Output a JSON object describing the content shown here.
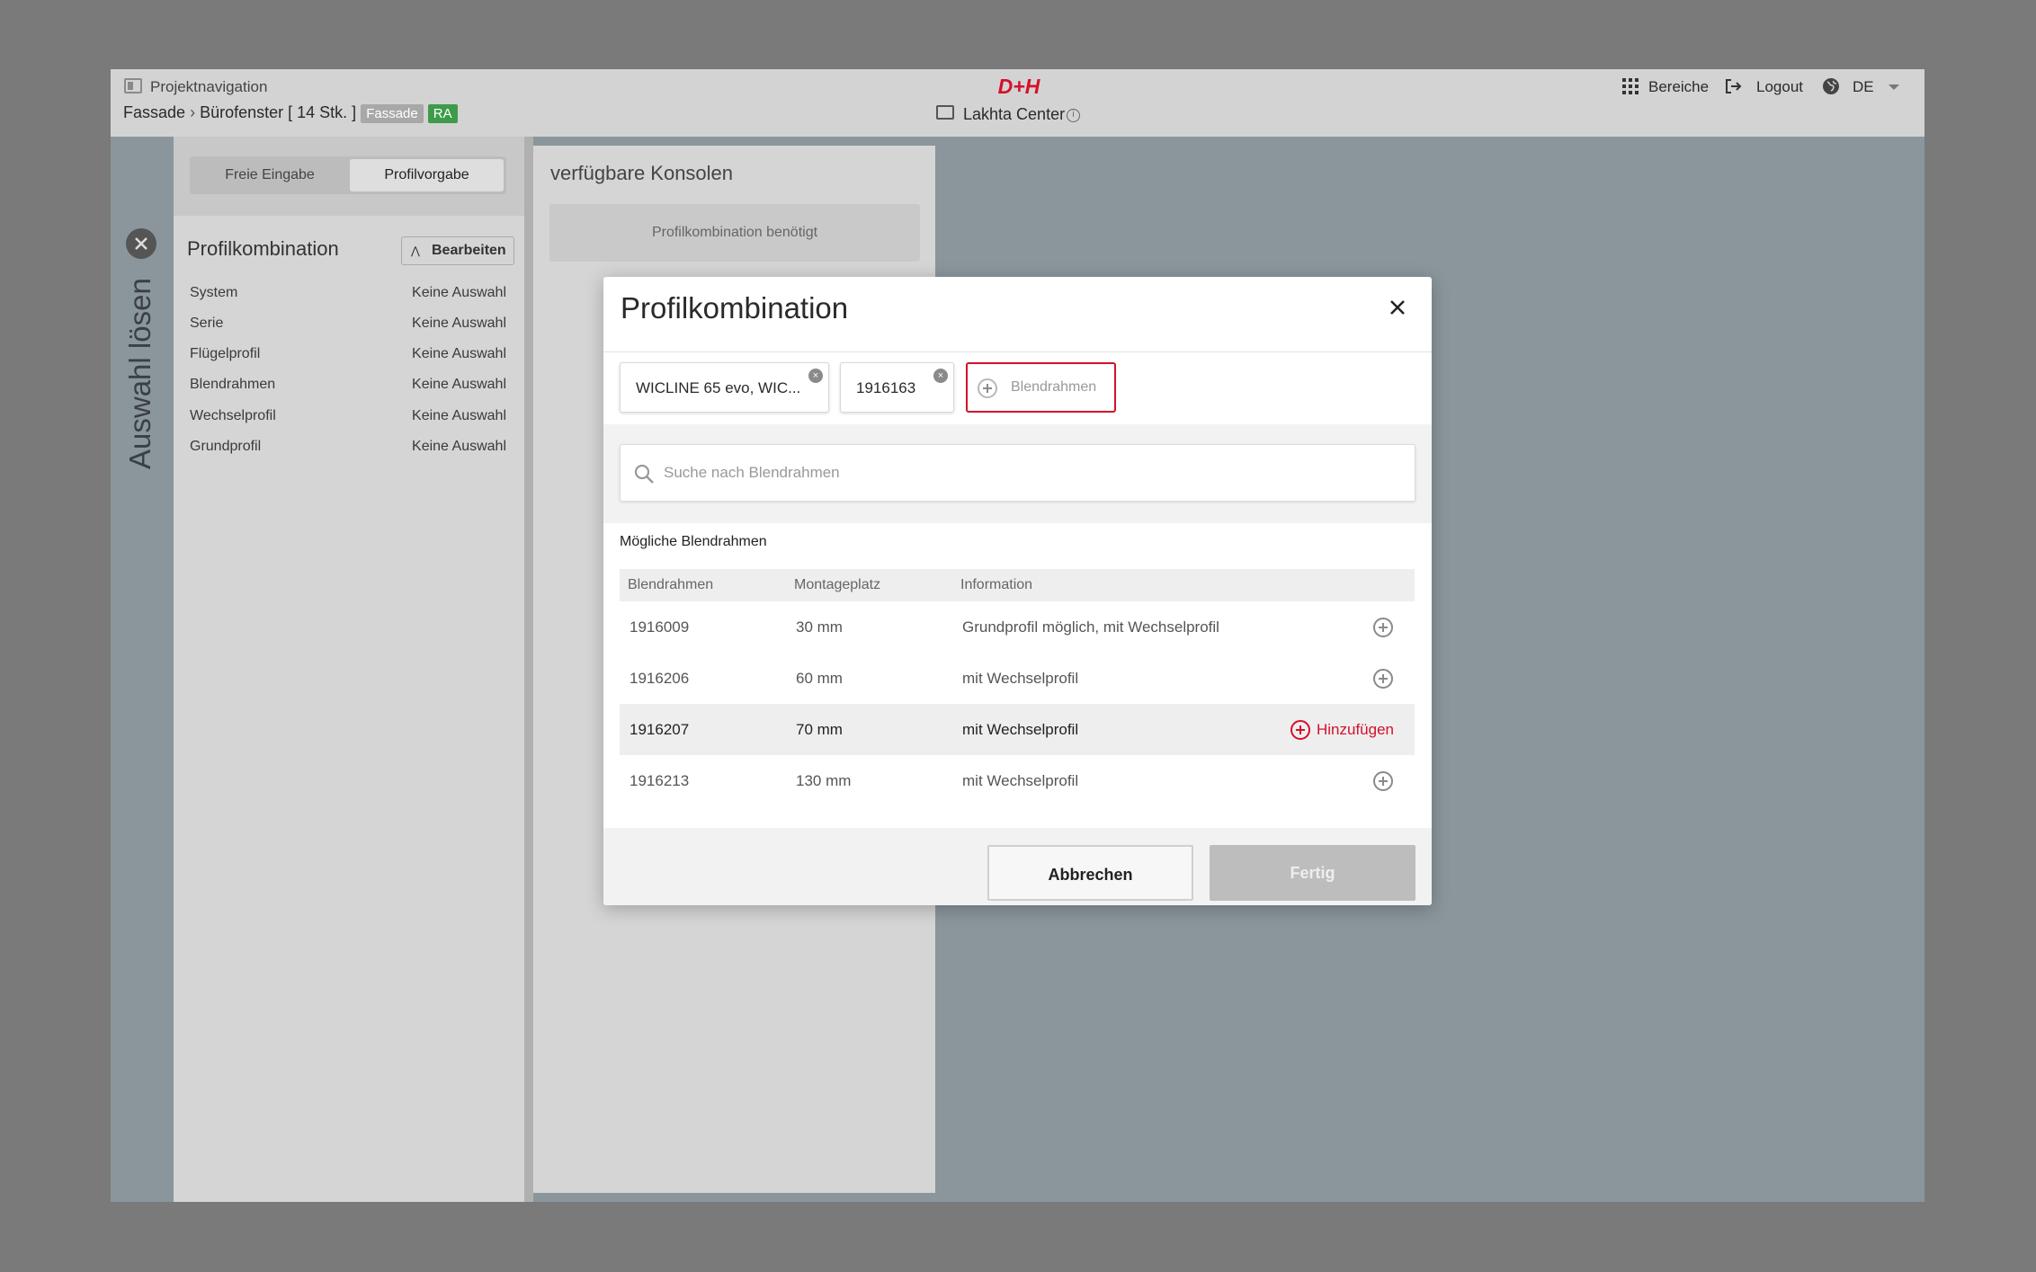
{
  "header": {
    "project_nav_label": "Projektnavigation",
    "breadcrumb_root": "Fassade",
    "breadcrumb_item": "Bürofenster [ 14 Stk. ]",
    "badge_fassade": "Fassade",
    "badge_ra": "RA",
    "project_name": "Lakhta Center",
    "bereiche_label": "Bereiche",
    "logout_label": "Logout",
    "language": "DE",
    "logo_text": "D+H"
  },
  "sidebar": {
    "vertical_label": "Auswahl lösen"
  },
  "panel": {
    "tabs": [
      "Freie Eingabe",
      "Profilvorgabe"
    ],
    "active_tab": "Profilvorgabe",
    "section_title": "Profilkombination",
    "edit_button": "Bearbeiten",
    "items": [
      {
        "label": "System",
        "value": "Keine Auswahl"
      },
      {
        "label": "Serie",
        "value": "Keine Auswahl"
      },
      {
        "label": "Flügelprofil",
        "value": "Keine Auswahl"
      },
      {
        "label": "Blendrahmen",
        "value": "Keine Auswahl"
      },
      {
        "label": "Wechselprofil",
        "value": "Keine Auswahl"
      },
      {
        "label": "Grundprofil",
        "value": "Keine Auswahl"
      }
    ]
  },
  "consoles": {
    "title": "verfügbare Konsolen",
    "placeholder": "Profilkombination benötigt"
  },
  "modal": {
    "title": "Profilkombination",
    "chips": [
      "WICLINE 65 evo, WIC...",
      "1916163"
    ],
    "add_chip_label": "Blendrahmen",
    "search_placeholder": "Suche nach Blendrahmen",
    "list_title": "Mögliche Blendrahmen",
    "columns": [
      "Blendrahmen",
      "Montageplatz",
      "Information"
    ],
    "rows": [
      {
        "id": "1916009",
        "place": "30 mm",
        "info": "Grundprofil möglich, mit Wechselprofil",
        "action": ""
      },
      {
        "id": "1916206",
        "place": "60 mm",
        "info": "mit Wechselprofil",
        "action": ""
      },
      {
        "id": "1916207",
        "place": "70 mm",
        "info": "mit Wechselprofil",
        "action": "Hinzufügen"
      },
      {
        "id": "1916213",
        "place": "130 mm",
        "info": "mit Wechselprofil",
        "action": ""
      }
    ],
    "cancel_button": "Abbrechen",
    "done_button": "Fertig"
  },
  "colors": {
    "accent": "#d4102b",
    "badge_fassade": "#a8a8a8",
    "badge_ra": "#3d9b4a"
  }
}
